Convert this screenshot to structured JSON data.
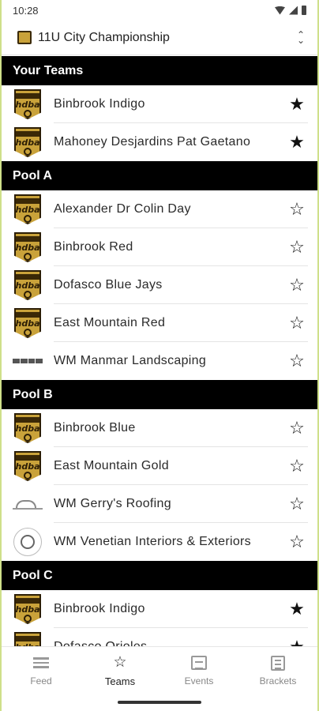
{
  "status": {
    "time": "10:28"
  },
  "header": {
    "title": "11U City Championship"
  },
  "sections": [
    {
      "title": "Your Teams",
      "teams": [
        {
          "name": "Binbrook Indigo",
          "logo": "hdba-shield",
          "favorite": true
        },
        {
          "name": "Mahoney Desjardins Pat Gaetano",
          "logo": "hdba-shield",
          "favorite": true
        }
      ]
    },
    {
      "title": "Pool A",
      "teams": [
        {
          "name": "Alexander Dr Colin Day",
          "logo": "hdba-shield",
          "favorite": false
        },
        {
          "name": "Binbrook Red",
          "logo": "hdba-shield",
          "favorite": false
        },
        {
          "name": "Dofasco Blue Jays",
          "logo": "hdba-shield",
          "favorite": false
        },
        {
          "name": "East Mountain Red",
          "logo": "hdba-shield",
          "favorite": false
        },
        {
          "name": "WM Manmar Landscaping",
          "logo": "wordmark",
          "favorite": false
        }
      ]
    },
    {
      "title": "Pool B",
      "teams": [
        {
          "name": "Binbrook Blue",
          "logo": "hdba-shield",
          "favorite": false
        },
        {
          "name": "East Mountain Gold",
          "logo": "hdba-shield",
          "favorite": false
        },
        {
          "name": "WM Gerry's Roofing",
          "logo": "roof",
          "favorite": false
        },
        {
          "name": "WM Venetian Interiors & Exteriors",
          "logo": "circle",
          "favorite": false
        }
      ]
    },
    {
      "title": "Pool C",
      "teams": [
        {
          "name": "Binbrook Indigo",
          "logo": "hdba-shield",
          "favorite": true
        },
        {
          "name": "Dofasco Orioles",
          "logo": "hdba-shield",
          "favorite": true
        }
      ]
    }
  ],
  "nav": [
    {
      "label": "Feed",
      "icon": "feed-icon",
      "active": false
    },
    {
      "label": "Teams",
      "icon": "star-icon",
      "active": true
    },
    {
      "label": "Events",
      "icon": "scoreboard-icon",
      "active": false
    },
    {
      "label": "Brackets",
      "icon": "bracket-list-icon",
      "active": false
    }
  ],
  "glyphs": {
    "star_filled": "★",
    "star_outline": "☆",
    "hdba_text": "hdba",
    "updown_up": "⌃",
    "updown_down": "⌄"
  }
}
